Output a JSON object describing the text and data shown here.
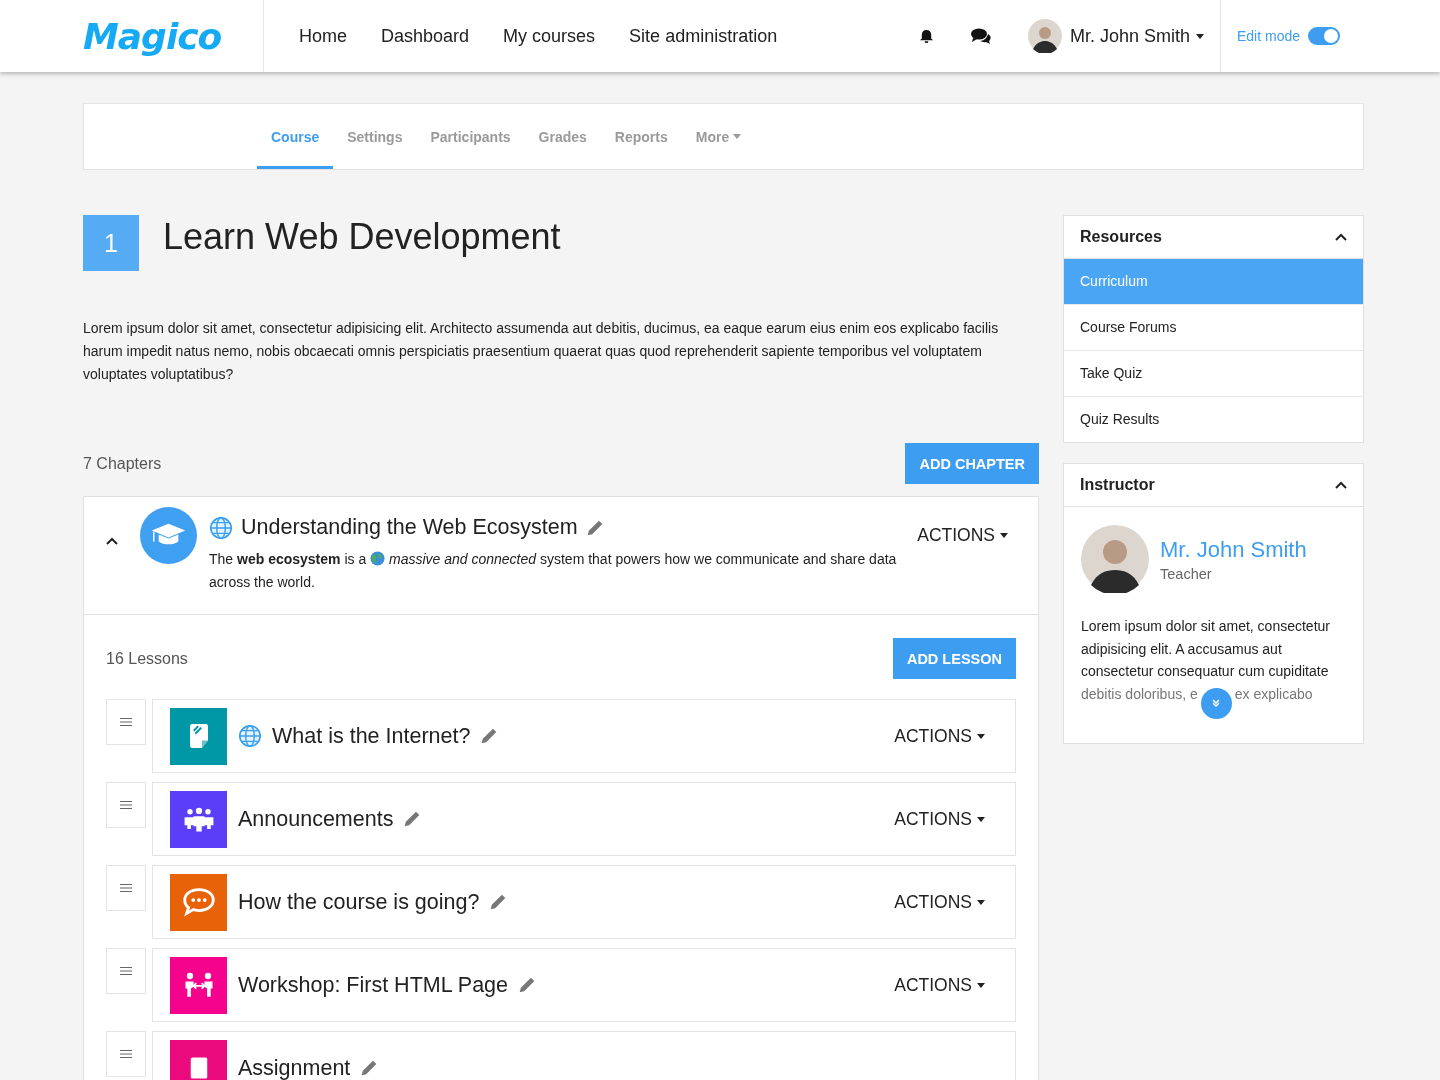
{
  "header": {
    "logo": "Magico",
    "nav": [
      {
        "label": "Home"
      },
      {
        "label": "Dashboard"
      },
      {
        "label": "My courses"
      },
      {
        "label": "Site administration"
      }
    ],
    "user": "Mr. John Smith",
    "edit_mode": {
      "label": "Edit mode",
      "on": true
    }
  },
  "tabs": [
    {
      "label": "Course",
      "selected": true
    },
    {
      "label": "Settings",
      "selected": false
    },
    {
      "label": "Participants",
      "selected": false
    },
    {
      "label": "Grades",
      "selected": false
    },
    {
      "label": "Reports",
      "selected": false
    },
    {
      "label": "More",
      "selected": false,
      "dropdown": true
    }
  ],
  "course": {
    "number": "1",
    "title": "Learn Web Development",
    "description": "Lorem ipsum dolor sit amet, consectetur adipisicing elit. Architecto assumenda aut debitis, ducimus, ea eaque earum eius enim eos explicabo facilis harum impedit natus nemo, nobis obcaecati omnis perspiciatis praesentium quaerat quas quod reprehenderit sapiente temporibus vel voluptatem voluptates voluptatibus?"
  },
  "chapters_count": "7 Chapters",
  "add_chapter": "ADD CHAPTER",
  "chapter": {
    "title": "Understanding the Web Ecosystem",
    "globe": true,
    "expanded": true,
    "description_start": "The **web ecosystem** is a",
    "description_end": "*massive and connected* system that powers how we communicate and share data across the world.",
    "actions": "ACTIONS",
    "lessons_count": "16 Lessons",
    "add_lesson": "ADD LESSON",
    "lessons": [
      {
        "kind": "page",
        "color": "#0097a7",
        "globe": true,
        "title": "What is the Internet?",
        "actions": "ACTIONS"
      },
      {
        "kind": "forum",
        "color": "#5b3ff8",
        "globe": false,
        "title": "Announcements",
        "actions": "ACTIONS"
      },
      {
        "kind": "feedback",
        "color": "#e8620a",
        "globe": false,
        "title": "How the course is going?",
        "actions": "ACTIONS"
      },
      {
        "kind": "workshop",
        "color": "#f5038c",
        "globe": false,
        "title": "Workshop: First HTML Page",
        "actions": "ACTIONS"
      },
      {
        "kind": "assignment",
        "color": "#ea0a7e",
        "globe": false,
        "title": "Assignment"
      }
    ]
  },
  "resources": {
    "title": "Resources",
    "expanded": true,
    "items": [
      {
        "label": "Curriculum",
        "selected": true
      },
      {
        "label": "Course Forums",
        "selected": false
      },
      {
        "label": "Take Quiz",
        "selected": false
      },
      {
        "label": "Quiz Results",
        "selected": false
      }
    ]
  },
  "instructor": {
    "title": "Instructor",
    "expanded": true,
    "name": "Mr. John Smith",
    "role": "Teacher",
    "bio": "Lorem ipsum dolor sit amet, consectetur adipisicing elit. A accusamus aut consectetur consequatur cum cupiditate",
    "bio_more": [
      "debitis doloribus, e",
      "ex explicabo"
    ]
  }
}
